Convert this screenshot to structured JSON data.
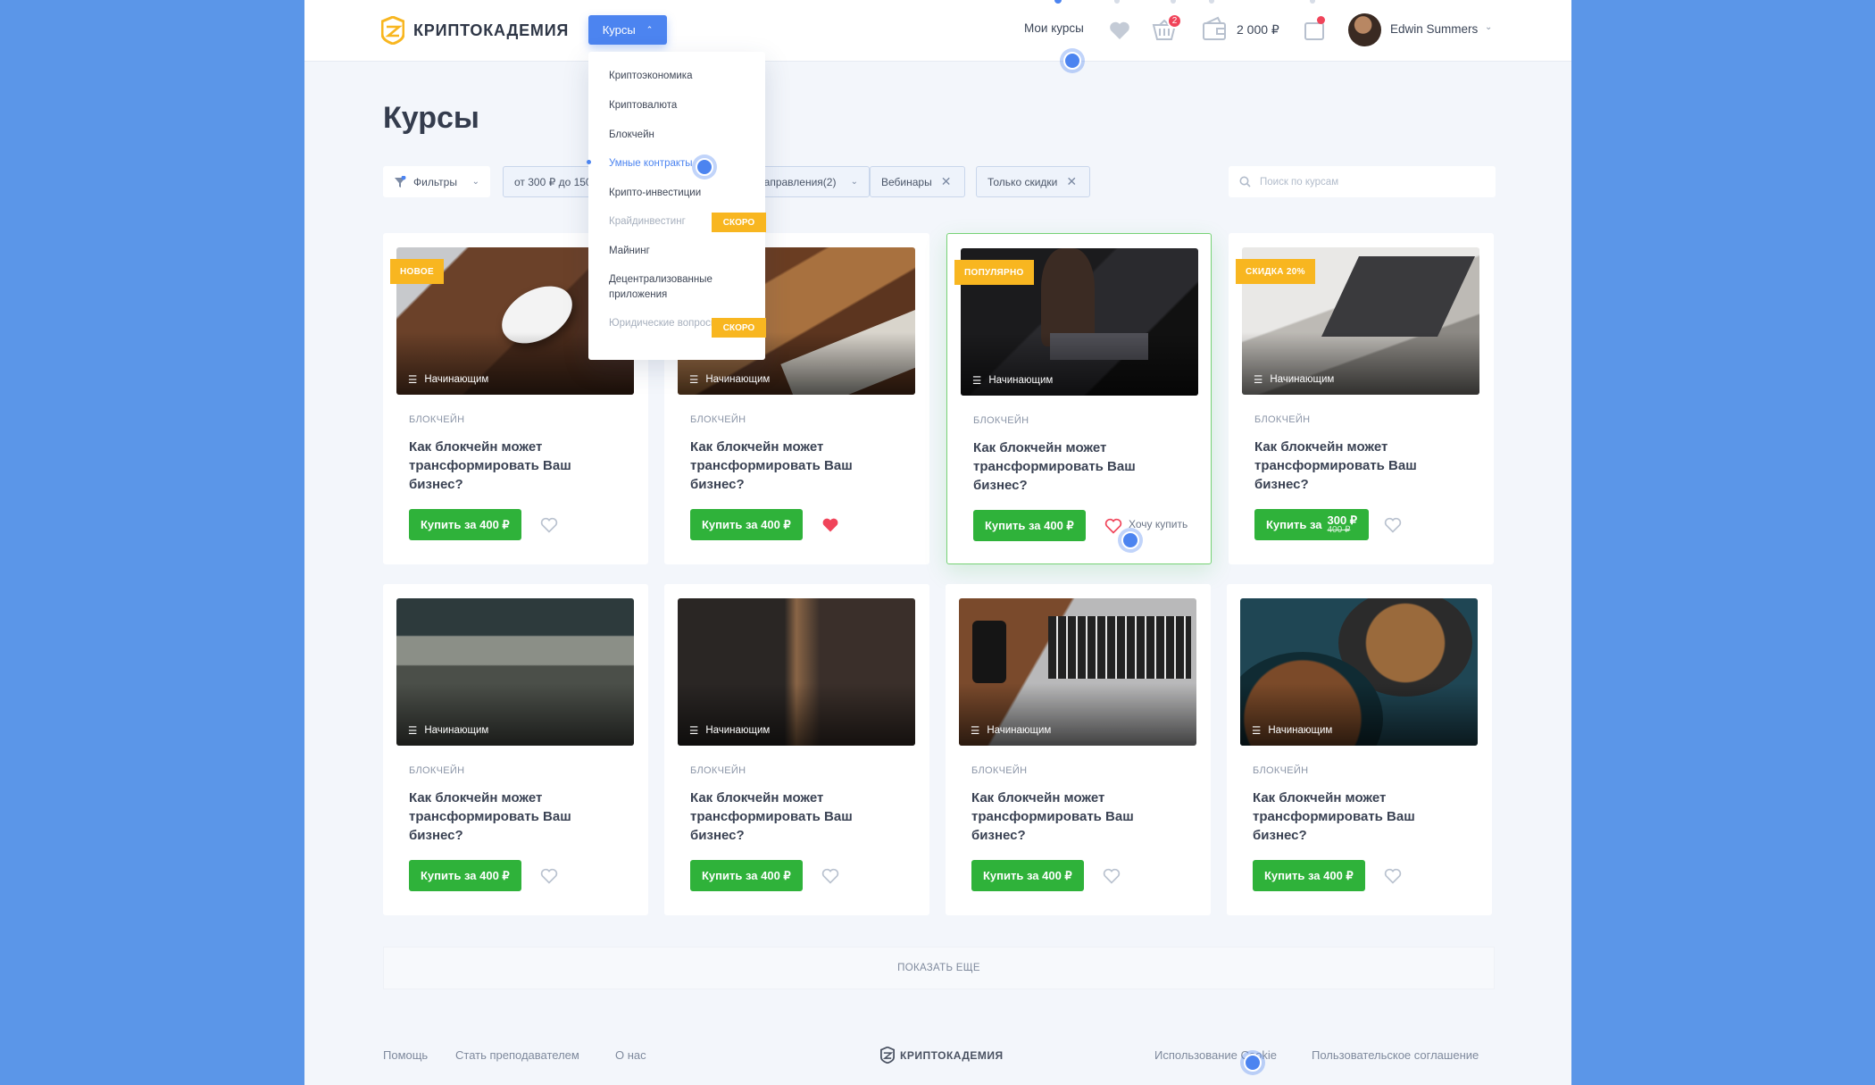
{
  "header": {
    "logo_text": "КРИПТОКАДЕМИЯ",
    "courses_button": "Курсы",
    "my_courses": "Мои курсы",
    "cart_count": "2",
    "wallet_amount": "2 000 ₽",
    "user_name": "Edwin Summers"
  },
  "page": {
    "title": "Курсы"
  },
  "filters": {
    "filters_label": "Фильтры",
    "price": "от 300 ₽ до 150",
    "directions": "Направления(2)",
    "webinars": "Вебинары",
    "discounts": "Только скидки",
    "search_placeholder": "Поиск по курсам"
  },
  "dropdown": {
    "items": [
      {
        "label": "Криптоэкономика"
      },
      {
        "label": "Криптовалюта"
      },
      {
        "label": "Блокчейн"
      },
      {
        "label": "Умные контракты"
      },
      {
        "label": "Крипто-инвестиции"
      },
      {
        "label": "Крайдинвестинг"
      },
      {
        "label": "Майнинг"
      },
      {
        "label": "Децентрализованные приложения"
      },
      {
        "label": "Юридические вопросы"
      }
    ],
    "soon_label": "СКОРО"
  },
  "cards": [
    {
      "tag": "НОВОЕ",
      "level": "Начинающим",
      "category": "БЛОКЧЕЙН",
      "title": "Как блокчейн может трансформировать Ваш бизнес?",
      "buy": "Купить за 400 ₽"
    },
    {
      "tag": "",
      "level": "Начинающим",
      "category": "БЛОКЧЕЙН",
      "title": "Как блокчейн может трансформировать Ваш бизнес?",
      "buy": "Купить за 400 ₽"
    },
    {
      "tag": "ПОПУЛЯРНО",
      "level": "Начинающим",
      "category": "БЛОКЧЕЙН",
      "title": "Как блокчейн может трансформировать Ваш бизнес?",
      "buy": "Купить за 400 ₽",
      "want": "Хочу купить"
    },
    {
      "tag": "СКИДКА 20%",
      "level": "Начинающим",
      "category": "БЛОКЧЕЙН",
      "title": "Как блокчейн может трансформировать Ваш бизнес?",
      "buy": "Купить за",
      "price_new": "300 ₽",
      "price_old": "400 ₽"
    },
    {
      "tag": "",
      "level": "Начинающим",
      "category": "БЛОКЧЕЙН",
      "title": "Как блокчейн может трансформировать Ваш бизнес?",
      "buy": "Купить за 400 ₽"
    },
    {
      "tag": "",
      "level": "Начинающим",
      "category": "БЛОКЧЕЙН",
      "title": "Как блокчейн может трансформировать Ваш бизнес?",
      "buy": "Купить за 400 ₽"
    },
    {
      "tag": "",
      "level": "Начинающим",
      "category": "БЛОКЧЕЙН",
      "title": "Как блокчейн может трансформировать Ваш бизнес?",
      "buy": "Купить за 400 ₽"
    },
    {
      "tag": "",
      "level": "Начинающим",
      "category": "БЛОКЧЕЙН",
      "title": "Как блокчейн может трансформировать Ваш бизнес?",
      "buy": "Купить за 400 ₽"
    }
  ],
  "show_more": "ПОКАЗАТЬ ЕЩЕ",
  "footer": {
    "help": "Помощь",
    "become_teacher": "Стать преподавателем",
    "about": "О нас",
    "logo_text": "КРИПТОКАДЕМИЯ",
    "cookie": "Использование Cookie",
    "agreement": "Пользовательское соглашение"
  },
  "colors": {
    "accent": "#4c84f0",
    "buy": "#2fb23a",
    "tag": "#f8b620",
    "liked": "#f0445a",
    "background": "#5b96e8"
  }
}
